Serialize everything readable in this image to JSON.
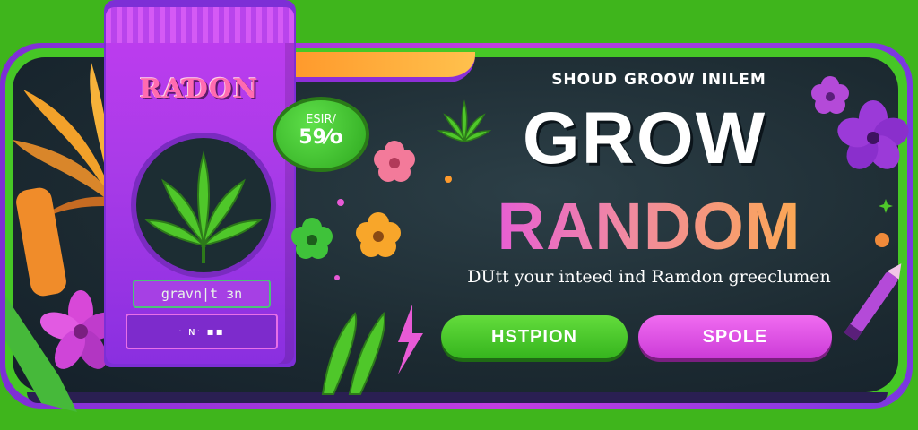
{
  "colors": {
    "background": "#3fb51c",
    "frame_purple": "#8d2fd8",
    "panel_dark": "#1c2a31",
    "title_white": "#ffffff",
    "title_gradient_start": "#e34de8",
    "title_gradient_end": "#ffb13a",
    "button_green": "#45c426",
    "button_pink": "#e04fe6"
  },
  "packet": {
    "brand": "RAƊON",
    "label": "gravn|t ɜn",
    "slot_text": "ᐧ ɴᐧ ▪▪"
  },
  "badge": {
    "top": "ESIR/",
    "value": "59⁄o"
  },
  "headline": {
    "subhead": "SHOUD GROOW INILEM",
    "title_line1": "GROW",
    "title_line2": "RANDOM",
    "tagline": "DUtt your inteed ind Ramdon greeclumen"
  },
  "buttons": {
    "primary": "HSTPION",
    "secondary": "SPOLE"
  },
  "icons": [
    "cannabis-leaf-icon",
    "flower-icon",
    "sparkle-icon",
    "lightning-icon",
    "pencil-icon",
    "pepper-icon"
  ]
}
